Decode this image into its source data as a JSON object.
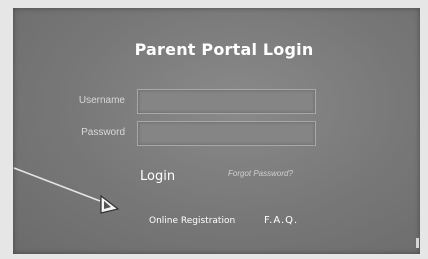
{
  "login": {
    "title": "Parent Portal Login",
    "username_label": "Username",
    "username_value": "",
    "password_label": "Password",
    "password_value": "",
    "login_label": "Login",
    "forgot_label": "Forgot Password?"
  },
  "footer": {
    "registration_label": "Online Registration",
    "faq_label": "F.A.Q."
  },
  "colors": {
    "panel": "#7b7b7b",
    "text": "#ffffff"
  },
  "icons": {
    "pointer": "cursor-arrow-icon"
  }
}
